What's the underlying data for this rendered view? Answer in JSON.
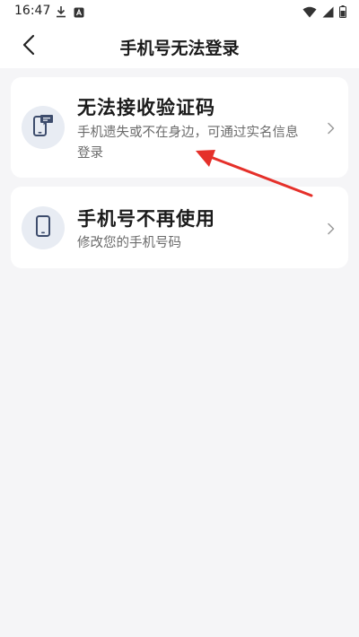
{
  "status_bar": {
    "time": "16:47",
    "left_icons": [
      "download-icon",
      "app-notification-icon"
    ],
    "right_icons": [
      "wifi-icon",
      "signal-icon",
      "battery-icon"
    ]
  },
  "header": {
    "title": "手机号无法登录",
    "back_icon": "chevron-left-icon"
  },
  "options": [
    {
      "title": "无法接收验证码",
      "description": "手机遗失或不在身边，可通过实名信息登录",
      "icon": "phone-message-icon"
    },
    {
      "title": "手机号不再使用",
      "description": "修改您的手机号码",
      "icon": "phone-icon"
    }
  ],
  "colors": {
    "background": "#f5f5f7",
    "card": "#ffffff",
    "icon_bg": "#e8ecf3",
    "icon_fg": "#3d4c6c",
    "annotation_arrow": "#e5302a"
  }
}
